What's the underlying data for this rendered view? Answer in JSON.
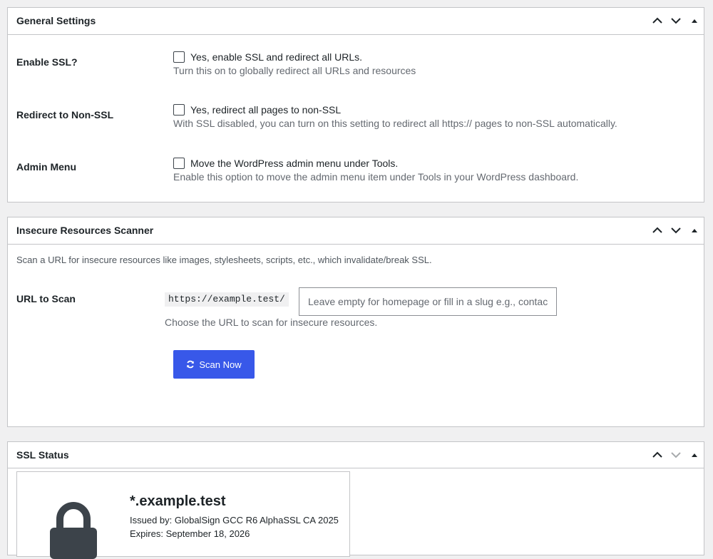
{
  "general": {
    "title": "General Settings",
    "rows": [
      {
        "label": "Enable SSL?",
        "checkbox_label": "Yes, enable SSL and redirect all URLs.",
        "description": "Turn this on to globally redirect all URLs and resources"
      },
      {
        "label": "Redirect to Non-SSL",
        "checkbox_label": "Yes, redirect all pages to non-SSL",
        "description": "With SSL disabled, you can turn on this setting to redirect all https:// pages to non-SSL automatically."
      },
      {
        "label": "Admin Menu",
        "checkbox_label": "Move the WordPress admin menu under Tools.",
        "description": "Enable this option to move the admin menu item under Tools in your WordPress dashboard."
      }
    ]
  },
  "scanner": {
    "title": "Insecure Resources Scanner",
    "intro": "Scan a URL for insecure resources like images, stylesheets, scripts, etc., which invalidate/break SSL.",
    "url_label": "URL to Scan",
    "url_prefix": "https://example.test/",
    "url_placeholder": "Leave empty for homepage or fill in a slug e.g., contact",
    "url_value": "",
    "url_description": "Choose the URL to scan for insecure resources.",
    "scan_button": "Scan Now"
  },
  "ssl_status": {
    "title": "SSL Status",
    "domain": "*.example.test",
    "issued_by": "Issued by: GlobalSign GCC R6 AlphaSSL CA 2025",
    "expires": "Expires: September 18, 2026"
  },
  "icons": {
    "move_up": "chevron-up-icon",
    "move_down": "chevron-down-icon",
    "toggle": "caret-up-icon",
    "scan": "refresh-icon",
    "lock": "lock-icon"
  },
  "colors": {
    "primary_button": "#3858e9",
    "border": "#c3c4c7",
    "background": "#f0f0f1",
    "muted_text": "#646970"
  }
}
